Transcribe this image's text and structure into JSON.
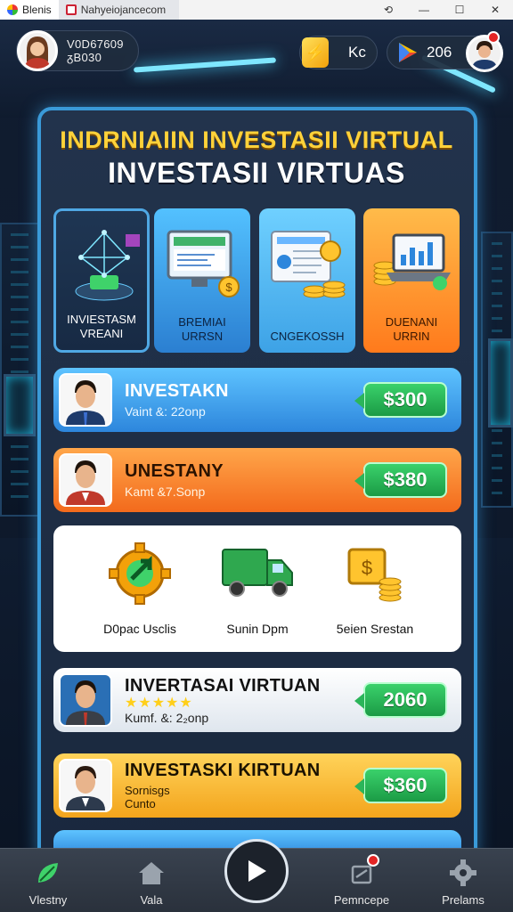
{
  "window": {
    "tab_active": "Blenis",
    "tab_url": "Nahyeiojancecom",
    "controls": [
      "⟲",
      "—",
      "☐",
      "✕"
    ]
  },
  "hud": {
    "profile_line1": "V0D67609",
    "profile_line2": "ᵹB030",
    "coin_label": "Kc",
    "gems_value": "206"
  },
  "panel": {
    "title_primary": "INDRNIAIIN INVESTASII VIRTUAL",
    "title_secondary": "INVESTASII VIRTUAS"
  },
  "tiles": [
    {
      "label_1": "INVIESTASM",
      "label_2": "VREANI",
      "icon": "hologram-network-icon"
    },
    {
      "label_1": "BREMIAI",
      "label_2": "URRSN",
      "icon": "computer-chart-icon"
    },
    {
      "label_1": "CNGEKOSSH",
      "label_2": "",
      "icon": "document-coins-icon"
    },
    {
      "label_1": "DUENANI",
      "label_2": "URRIN",
      "icon": "laptop-chart-icon"
    }
  ],
  "rows": [
    {
      "title": "INVESTAKN",
      "sub": "Vaint &: 22onp",
      "price": "$300",
      "color": "blue"
    },
    {
      "title": "UNESTANY",
      "sub": "Kamt &7.Sonp",
      "price": "$380",
      "color": "orange"
    }
  ],
  "features": [
    {
      "label": "D0pac Usclis",
      "icon": "gear-arrow-icon"
    },
    {
      "label": "Sunin Dpm",
      "icon": "truck-icon"
    },
    {
      "label": "5eien Srestan",
      "icon": "gold-coins-icon"
    }
  ],
  "rows_lower": [
    {
      "title": "INVERTASAI VIRTUAN",
      "stars": "★★★★★",
      "sub": "Kumf. &: 2₂onp",
      "price": "2060",
      "color": "white"
    },
    {
      "title": "INVESTASKI KIRTUAN",
      "sub_1": "Sornisgs",
      "sub_2": "Cunto",
      "price": "$360",
      "color": "yellow"
    }
  ],
  "bottom_nav": [
    {
      "label": "Vlestny",
      "icon": "green-leaf-icon"
    },
    {
      "label": "Vala",
      "icon": "home-icon"
    },
    {
      "label": "Pemncepe",
      "icon": "cart-icon"
    },
    {
      "label": "Prelams",
      "icon": "gear-icon"
    }
  ]
}
